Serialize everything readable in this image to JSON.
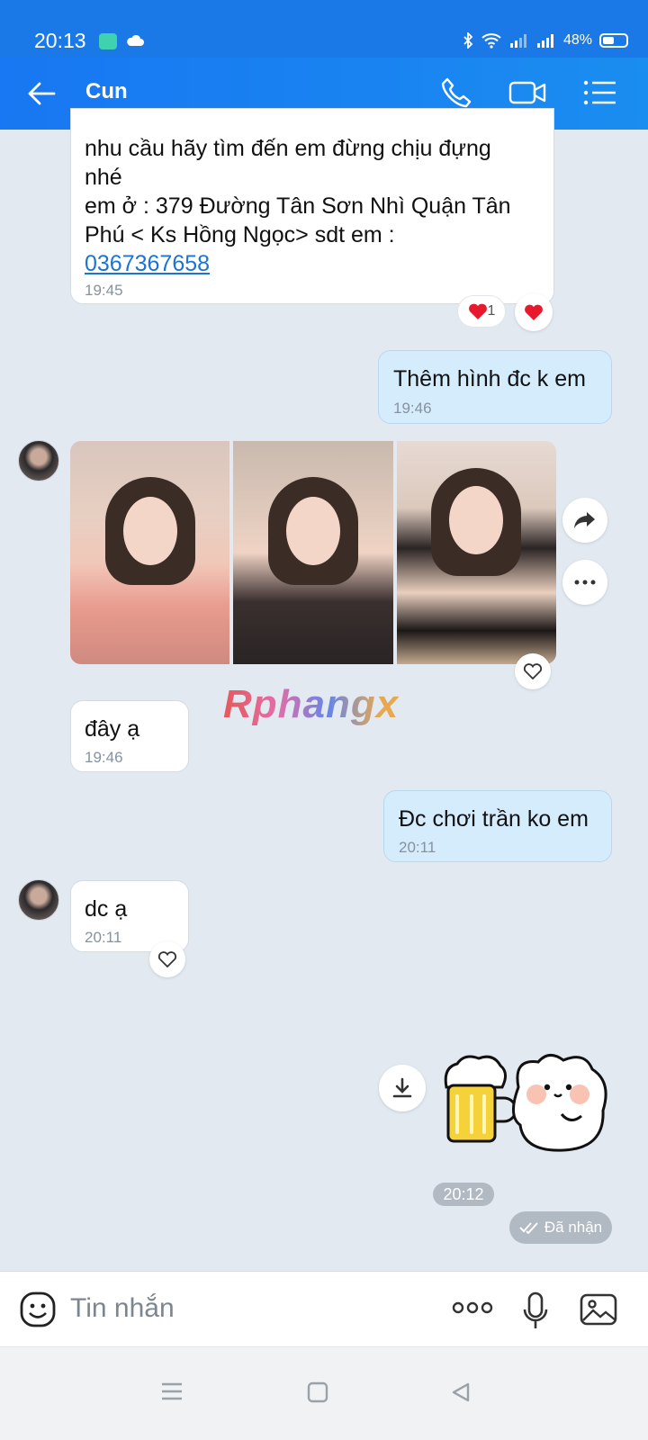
{
  "status": {
    "time": "20:13",
    "battery_text": "48%",
    "battery_level": 0.48
  },
  "header": {
    "contact_name": "Cun",
    "icons": [
      "back-arrow-icon",
      "phone-icon",
      "video-icon",
      "menu-icon"
    ]
  },
  "messages": {
    "m1": {
      "line1": "nhu cầu hãy tìm đến em đừng chịu đựng",
      "line2": "nhé",
      "line3": "em ở : 379 Đường Tân Sơn Nhì Quận Tân",
      "line4": "Phú < Ks Hồng Ngọc> sdt em :",
      "phone": "0367367658",
      "time": "19:45",
      "reaction_count": "1"
    },
    "m2": {
      "text": "Thêm hình đc k em",
      "time": "19:46"
    },
    "m3": {
      "text": "đây ạ",
      "time": "19:46"
    },
    "m4": {
      "text": "Đc chơi trần ko em",
      "time": "20:11"
    },
    "m5": {
      "text": "dc ạ",
      "time": "20:11"
    }
  },
  "watermark": "Rphangx",
  "sticker_time": "20:12",
  "status_received": "Đã nhận",
  "input": {
    "placeholder": "Tin nhắn"
  },
  "colors": {
    "header": "#1877f2",
    "my_bubble": "#d5ecfd",
    "link": "#1a73d6",
    "heart": "#e8192c"
  }
}
